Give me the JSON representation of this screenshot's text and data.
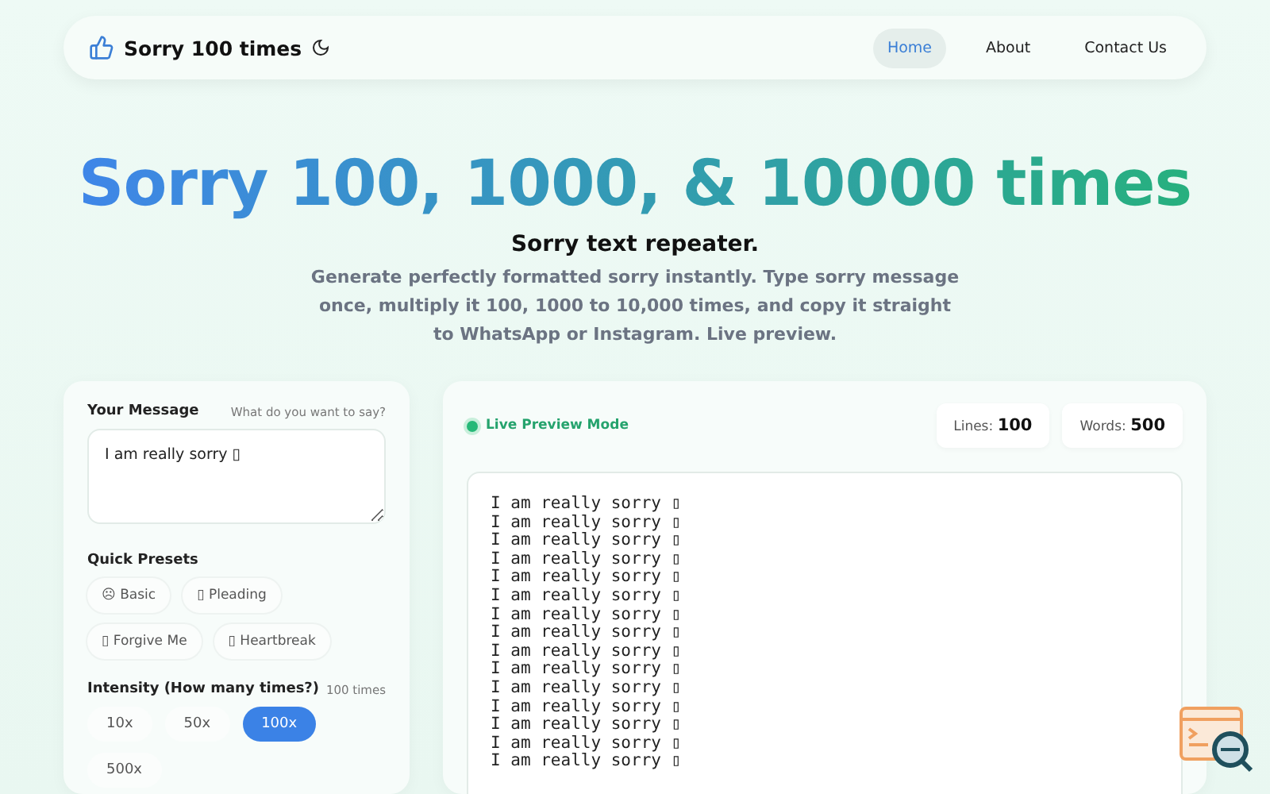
{
  "nav": {
    "brand": "Sorry 100 times",
    "links": [
      {
        "label": "Home",
        "selected": true
      },
      {
        "label": "About",
        "selected": false
      },
      {
        "label": "Contact Us",
        "selected": false
      }
    ]
  },
  "hero": {
    "title": "Sorry 100, 1000, & 10000 times",
    "subtitle": "Sorry text repeater.",
    "description": "Generate perfectly formatted sorry instantly. Type sorry message once, multiply it 100, 1000 to 10,000 times, and copy it straight to WhatsApp or Instagram. Live preview."
  },
  "settings": {
    "message_label": "Your Message",
    "message_hint": "What do you want to say?",
    "message_value": "I am really sorry ▯",
    "presets_label": "Quick Presets",
    "presets": [
      {
        "label": "☹ Basic"
      },
      {
        "label": "▯ Pleading"
      },
      {
        "label": "▯ Forgive Me"
      },
      {
        "label": "▯ Heartbreak"
      }
    ],
    "intensity_label": "Intensity (How many times?)",
    "intensity_value": "100 times",
    "intensities": [
      {
        "label": "10x",
        "selected": false
      },
      {
        "label": "50x",
        "selected": false
      },
      {
        "label": "100x",
        "selected": true
      },
      {
        "label": "500x",
        "selected": false
      }
    ]
  },
  "preview": {
    "mode_label": "Live Preview Mode",
    "live": true,
    "stats": [
      {
        "label": "Lines:",
        "value": "100"
      },
      {
        "label": "Words:",
        "value": "500"
      }
    ],
    "lines": [
      "I am really sorry ▯",
      "I am really sorry ▯",
      "I am really sorry ▯",
      "I am really sorry ▯",
      "I am really sorry ▯",
      "I am really sorry ▯",
      "I am really sorry ▯",
      "I am really sorry ▯",
      "I am really sorry ▯",
      "I am really sorry ▯",
      "I am really sorry ▯",
      "I am really sorry ▯",
      "I am really sorry ▯",
      "I am really sorry ▯",
      "I am really sorry ▯"
    ]
  }
}
